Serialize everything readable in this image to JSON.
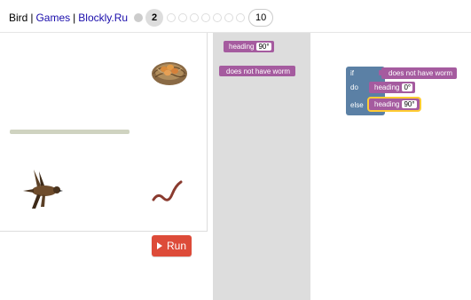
{
  "header": {
    "title": "Bird",
    "sep1": "|",
    "games_link": "Games",
    "sep2": "|",
    "site_link": "Blockly.Ru"
  },
  "levels": {
    "current": "2",
    "last": "10",
    "completed_count": 1,
    "pending_count": 7
  },
  "game": {
    "run_label": "Run"
  },
  "toolbox": {
    "heading_label": "heading",
    "heading_value": "90°",
    "worm_label": "does not have worm"
  },
  "workspace": {
    "if_label": "if",
    "do_label": "do",
    "else_label": "else",
    "condition_label": "does not have worm",
    "do_heading_label": "heading",
    "do_heading_value": "0°",
    "else_heading_label": "heading",
    "else_heading_value": "90°"
  },
  "colors": {
    "run_button": "#dd4b39",
    "logic_block": "#5b80a5",
    "bird_block": "#a55b9f",
    "toolbox_bg": "#dddddd",
    "link": "#1a0dab"
  }
}
